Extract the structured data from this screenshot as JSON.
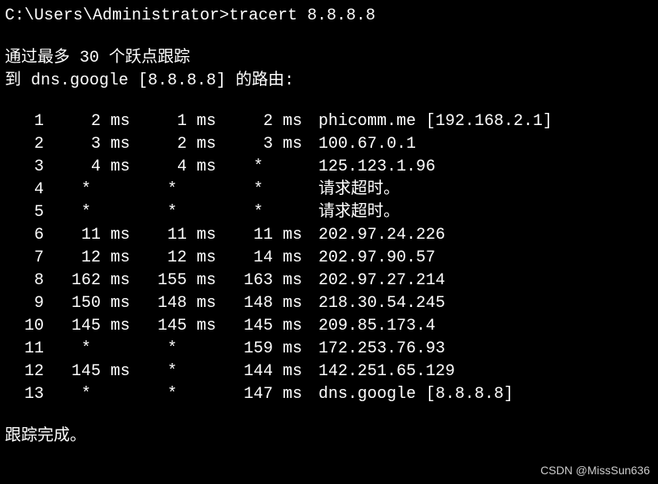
{
  "prompt": "C:\\Users\\Administrator>",
  "command": "tracert 8.8.8.8",
  "header_line1": "通过最多 30 个跃点跟踪",
  "header_line2": "到 dns.google [8.8.8.8] 的路由:",
  "hops": [
    {
      "n": "1",
      "t1": "2 ms",
      "t2": "1 ms",
      "t3": "2 ms",
      "dest": "phicomm.me [192.168.2.1]"
    },
    {
      "n": "2",
      "t1": "3 ms",
      "t2": "2 ms",
      "t3": "3 ms",
      "dest": "100.67.0.1"
    },
    {
      "n": "3",
      "t1": "4 ms",
      "t2": "4 ms",
      "t3": "*    ",
      "dest": "125.123.1.96"
    },
    {
      "n": "4",
      "t1": "*    ",
      "t2": "*    ",
      "t3": "*    ",
      "dest": "请求超时。"
    },
    {
      "n": "5",
      "t1": "*    ",
      "t2": "*    ",
      "t3": "*    ",
      "dest": "请求超时。"
    },
    {
      "n": "6",
      "t1": "11 ms",
      "t2": "11 ms",
      "t3": "11 ms",
      "dest": "202.97.24.226"
    },
    {
      "n": "7",
      "t1": "12 ms",
      "t2": "12 ms",
      "t3": "14 ms",
      "dest": "202.97.90.57"
    },
    {
      "n": "8",
      "t1": "162 ms",
      "t2": "155 ms",
      "t3": "163 ms",
      "dest": "202.97.27.214"
    },
    {
      "n": "9",
      "t1": "150 ms",
      "t2": "148 ms",
      "t3": "148 ms",
      "dest": "218.30.54.245"
    },
    {
      "n": "10",
      "t1": "145 ms",
      "t2": "145 ms",
      "t3": "145 ms",
      "dest": "209.85.173.4"
    },
    {
      "n": "11",
      "t1": "*    ",
      "t2": "*    ",
      "t3": "159 ms",
      "dest": "172.253.76.93"
    },
    {
      "n": "12",
      "t1": "145 ms",
      "t2": "*    ",
      "t3": "144 ms",
      "dest": "142.251.65.129"
    },
    {
      "n": "13",
      "t1": "*    ",
      "t2": "*    ",
      "t3": "147 ms",
      "dest": "dns.google [8.8.8.8]"
    }
  ],
  "footer": "跟踪完成。",
  "watermark": "CSDN @MissSun636"
}
